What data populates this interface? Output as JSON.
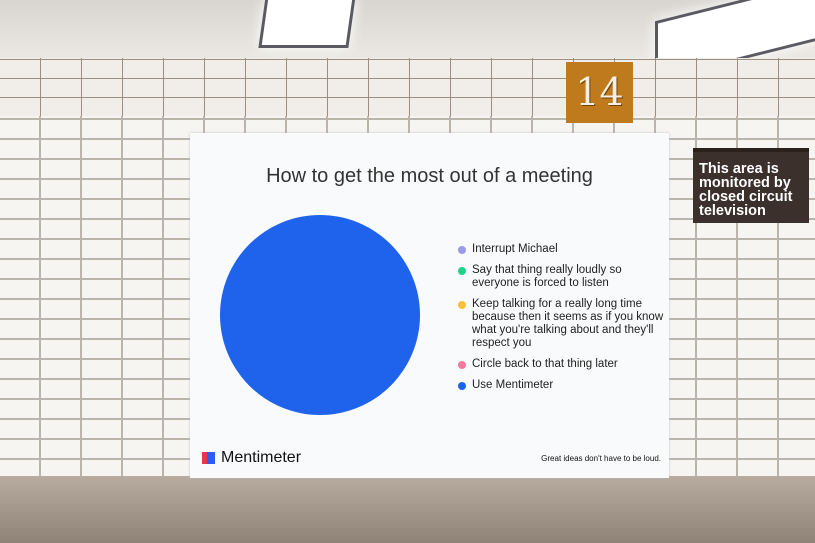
{
  "station": {
    "number": "14",
    "sign_text": "This area is monitored by closed circuit television"
  },
  "poster": {
    "brand": "Mentimeter",
    "tagline": "Great ideas don't have to be loud."
  },
  "chart_data": {
    "type": "pie",
    "title": "How to get the most out of a meeting",
    "categories": [
      "Interrupt Michael",
      "Say that thing really loudly so everyone is forced to listen",
      "Keep talking for a really long time because then it seems as if you know what you're talking about and they'll respect you",
      "Circle back to that thing later",
      "Use Mentimeter"
    ],
    "values": [
      0,
      0,
      0,
      0,
      100
    ],
    "colors": [
      "#9b9ae8",
      "#1ed38a",
      "#f6c13a",
      "#f27a9c",
      "#1f63ec"
    ],
    "legend": "right"
  }
}
